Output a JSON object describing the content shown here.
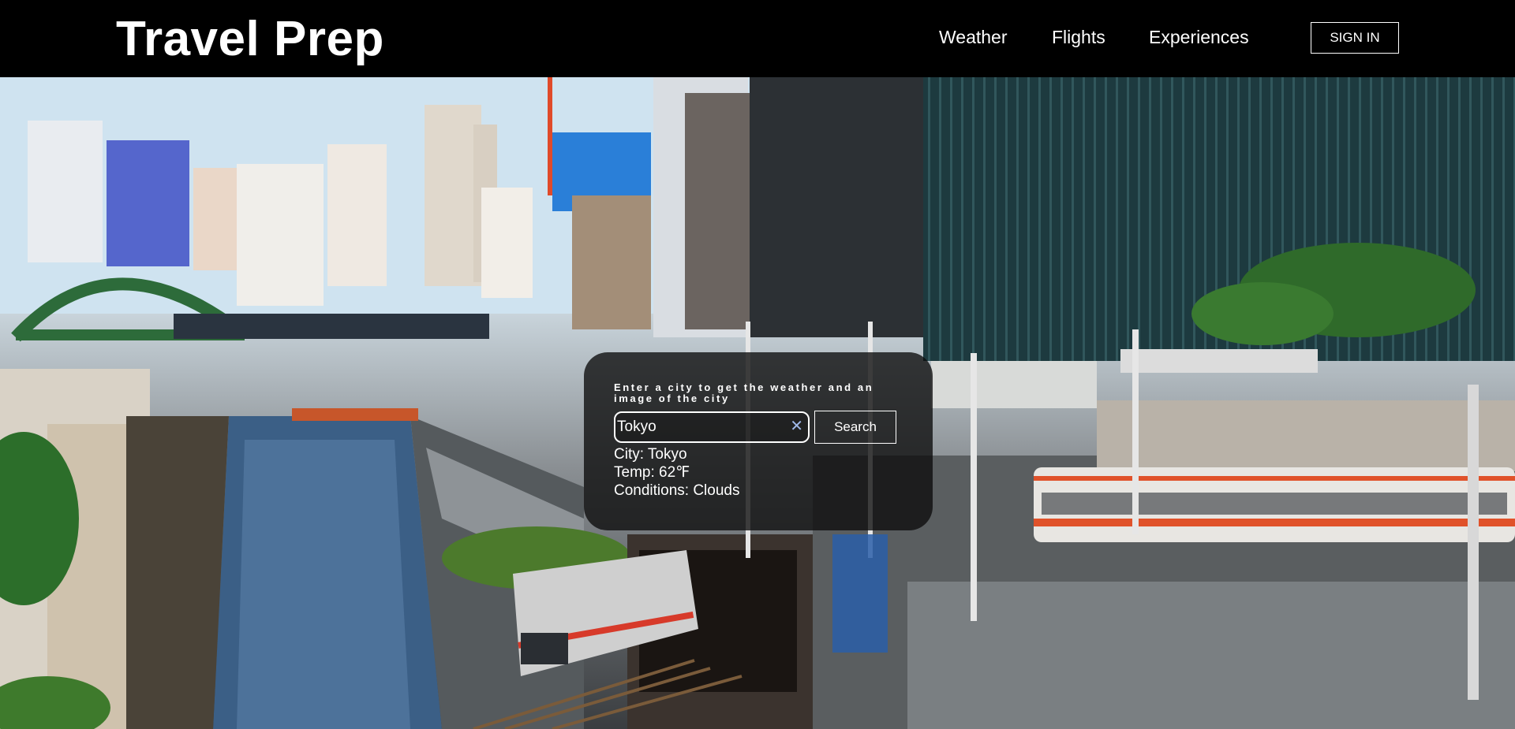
{
  "app": {
    "brand": "Travel Prep"
  },
  "nav": {
    "items": [
      {
        "label": "Weather"
      },
      {
        "label": "Flights"
      },
      {
        "label": "Experiences"
      }
    ],
    "signin_label": "SIGN IN"
  },
  "weather_panel": {
    "prompt": "Enter a city to get the weather and an image of the city",
    "search": {
      "value": "Tokyo",
      "clear_icon": "close-icon",
      "button_label": "Search"
    },
    "results": {
      "city": "City: Tokyo",
      "temp": "Temp: 62℉",
      "conditions": "Conditions: Clouds"
    }
  },
  "background": {
    "description_icon": "city-photo"
  }
}
